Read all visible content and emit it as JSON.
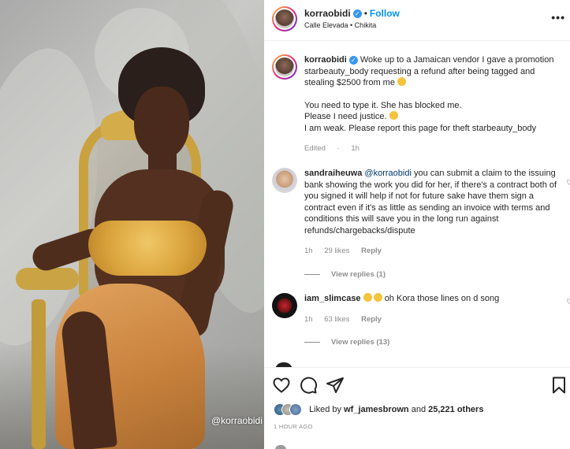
{
  "media": {
    "watermark": "@korraobidi"
  },
  "header": {
    "username": "korraobidi",
    "separator": "•",
    "follow_label": "Follow",
    "location": "Calle Elevada • Chikita",
    "more_icon": "more-horizontal-icon"
  },
  "caption": {
    "username": "korraobidi",
    "line1": "Woke up to a Jamaican vendor I gave a promotion starbeauty_body requesting a refund after being tagged and stealing $2500 from me",
    "line2": "You need to type it. She has blocked me.",
    "line3": "Please I need justice.",
    "line4": "I am weak. Please report this page for theft starbeauty_body",
    "edited": "Edited",
    "dot": "·",
    "time": "1h"
  },
  "comments": [
    {
      "username": "sandraiheuwa",
      "mention": "@korraobidi",
      "text": "you can submit a claim to the issuing bank showing the work you did for her, if there's a contract both of you signed it will help if not for future sake have them sign a contract even if it's as little as sending an invoice with terms and conditions this will save you in the long run against refunds/chargebacks/dispute",
      "time": "1h",
      "likes": "29 likes",
      "reply": "Reply",
      "view_replies": "View replies (1)"
    },
    {
      "username": "iam_slimcase",
      "text": "oh Kora those lines on d song",
      "time": "1h",
      "likes": "63 likes",
      "reply": "Reply",
      "view_replies": "View replies (13)"
    }
  ],
  "actions": {
    "liked_prefix": "Liked by",
    "liked_user": "wf_jamesbrown",
    "liked_and": "and",
    "liked_count": "25,221 others",
    "time_ago": "1 HOUR AGO"
  },
  "colors": {
    "accent": "#0095f6",
    "verified": "#3897f0",
    "muted": "#8e8e8e",
    "text": "#262626"
  }
}
